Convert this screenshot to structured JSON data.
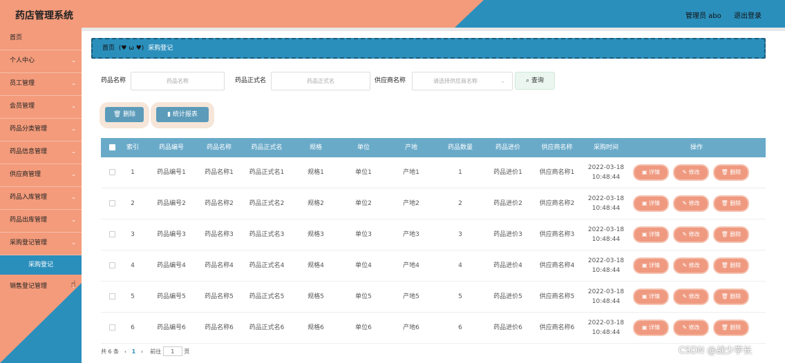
{
  "app": {
    "title": "药店管理系统",
    "admin": "管理员 abo",
    "logout": "退出登录"
  },
  "sidebar": {
    "items": [
      {
        "label": "首页",
        "chev": ""
      },
      {
        "label": "个人中心",
        "chev": "⌄"
      },
      {
        "label": "员工管理",
        "chev": "⌄"
      },
      {
        "label": "会员管理",
        "chev": "⌄"
      },
      {
        "label": "药品分类管理",
        "chev": "⌄"
      },
      {
        "label": "药品信息管理",
        "chev": "⌄"
      },
      {
        "label": "供应商管理",
        "chev": "⌄"
      },
      {
        "label": "药品入库管理",
        "chev": "⌄"
      },
      {
        "label": "药品出库管理",
        "chev": "⌄"
      },
      {
        "label": "采购登记管理",
        "chev": "⌄"
      }
    ],
    "active_sub": "采购登记",
    "last_item": {
      "label": "销售登记管理",
      "chev": "⌄"
    }
  },
  "breadcrumb": {
    "home": "首页",
    "face": "(♥ ω ♥)",
    "current": "采购登记"
  },
  "filters": {
    "name_label": "药品名称",
    "name_placeholder": "药品名称",
    "formal_label": "药品正式名",
    "formal_placeholder": "药品正式名",
    "supplier_label": "供应商名称",
    "supplier_placeholder": "请选择供应商名称",
    "search_btn": "查询"
  },
  "actions": {
    "delete": "删除",
    "report": "统计报表"
  },
  "table": {
    "headers": [
      "索引",
      "药品编号",
      "药品名称",
      "药品正式名",
      "规格",
      "单位",
      "产地",
      "药品数量",
      "药品进价",
      "供应商名称",
      "采购时间",
      "操作"
    ],
    "rows": [
      [
        "1",
        "药品编号1",
        "药品名称1",
        "药品正式名1",
        "规格1",
        "单位1",
        "产地1",
        "1",
        "药品进价1",
        "供应商名称1",
        "2022-03-18",
        "10:48:44"
      ],
      [
        "2",
        "药品编号2",
        "药品名称2",
        "药品正式名2",
        "规格2",
        "单位2",
        "产地2",
        "2",
        "药品进价2",
        "供应商名称2",
        "2022-03-18",
        "10:48:44"
      ],
      [
        "3",
        "药品编号3",
        "药品名称3",
        "药品正式名3",
        "规格3",
        "单位3",
        "产地3",
        "3",
        "药品进价3",
        "供应商名称3",
        "2022-03-18",
        "10:48:44"
      ],
      [
        "4",
        "药品编号4",
        "药品名称4",
        "药品正式名4",
        "规格4",
        "单位4",
        "产地4",
        "4",
        "药品进价4",
        "供应商名称4",
        "2022-03-18",
        "10:48:44"
      ],
      [
        "5",
        "药品编号5",
        "药品名称5",
        "药品正式名5",
        "规格5",
        "单位5",
        "产地5",
        "5",
        "药品进价5",
        "供应商名称5",
        "2022-03-18",
        "10:48:44"
      ],
      [
        "6",
        "药品编号6",
        "药品名称6",
        "药品正式名6",
        "规格6",
        "单位6",
        "产地6",
        "6",
        "药品进价6",
        "供应商名称6",
        "2022-03-18",
        "10:48:44"
      ]
    ],
    "ops": {
      "detail": "详情",
      "edit": "修改",
      "delete": "删除"
    }
  },
  "pager": {
    "total": "共 6 条",
    "prev": "‹",
    "page": "1",
    "next": "›",
    "goto": "前往",
    "goto_value": "1",
    "unit": "页"
  },
  "watermark": "CSDN @战少学长",
  "colors": {
    "salmon": "#f39b7b",
    "blue": "#2b8fbc",
    "header": "#6aaac9",
    "op": "#ef9a80"
  }
}
